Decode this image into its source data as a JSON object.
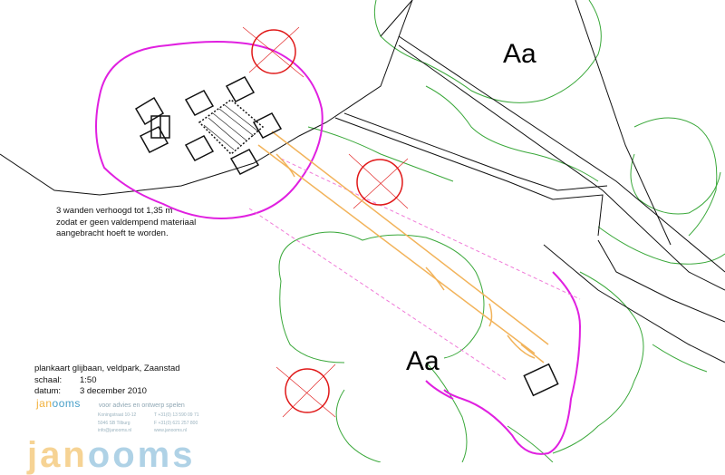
{
  "labels": {
    "zone_top": "Aa",
    "zone_bottom": "Aa"
  },
  "note": "3 wanden verhoogd tot 1,35 m\nzodat er geen valdempend materiaal\naangebracht hoeft te worden.",
  "title_block": {
    "title": "plankaart glijbaan, veldpark, Zaanstad",
    "scale_label": "schaal:",
    "scale_value": "1:50",
    "date_label": "datum:",
    "date_value": "3 december 2010"
  },
  "brand": {
    "logo_part1": "jan",
    "logo_part2": "ooms",
    "tagline": "voor advies en ontwerp spelen",
    "address": "Koningstraat 10-12\n5046 SB Tilburg\ninfo@janooms.nl",
    "phone": "T +31(0) 13 590 09 71\nF +31(0) 621 257 800\nwww.janooms.nl",
    "big_logo_part1": "jan",
    "big_logo_part2": "ooms"
  },
  "colors": {
    "magenta": "#e020e0",
    "tree_green": "#3aa83a",
    "red_circle": "#e01818",
    "orange": "#f2b35a",
    "pink_dash": "#f07ad8",
    "line_black": "#111111",
    "brand_orange": "#f2b13d",
    "brand_blue": "#4aa0c9"
  }
}
